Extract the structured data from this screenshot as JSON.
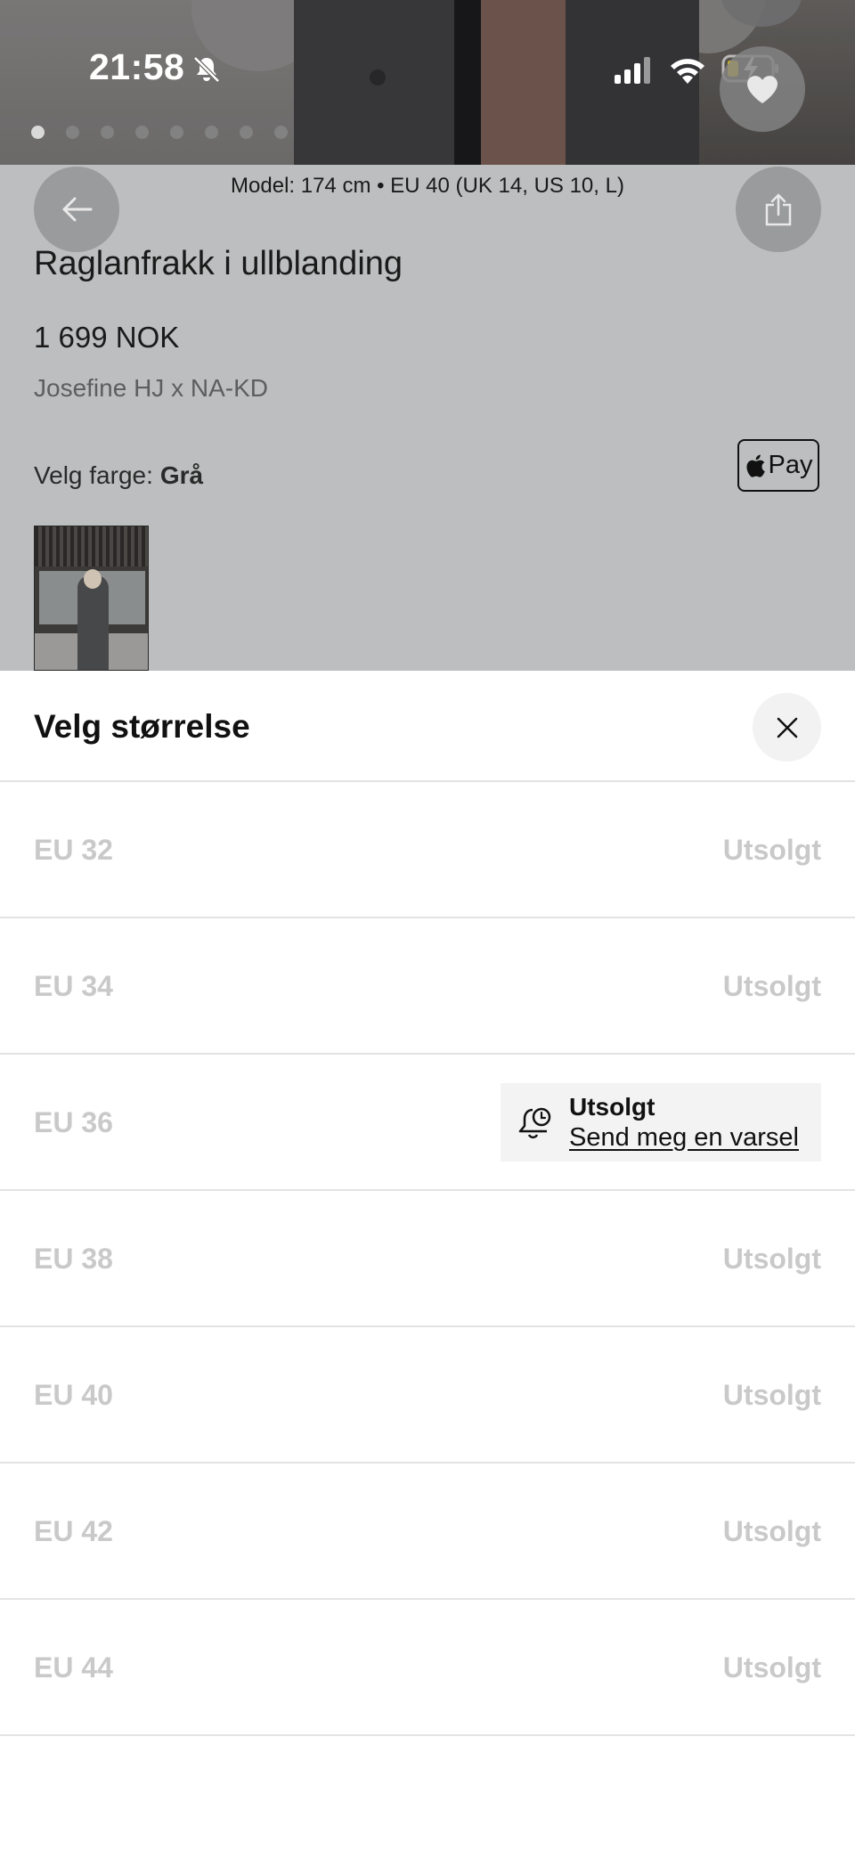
{
  "status_bar": {
    "time": "21:58"
  },
  "gallery": {
    "image_count": 8,
    "active_index": 0
  },
  "product": {
    "model_info": "Model: 174 cm • EU 40 (UK 14, US 10, L)",
    "title": "Raglanfrakk i ullblanding",
    "price": "1 699 NOK",
    "brand": "Josefine HJ x NA-KD",
    "color_label": "Velg farge:",
    "color_value": "Grå",
    "apple_pay_label": "Pay"
  },
  "size_sheet": {
    "title": "Velg størrelse",
    "sizes": [
      {
        "label": "EU 32",
        "status": "Utsolgt"
      },
      {
        "label": "EU 34",
        "status": "Utsolgt"
      },
      {
        "label": "EU 36",
        "status": "Utsolgt",
        "notify_link": "Send meg en varsel"
      },
      {
        "label": "EU 38",
        "status": "Utsolgt"
      },
      {
        "label": "EU 40",
        "status": "Utsolgt"
      },
      {
        "label": "EU 42",
        "status": "Utsolgt"
      },
      {
        "label": "EU 44",
        "status": "Utsolgt"
      }
    ]
  },
  "colors": {
    "overlay_panel": "#bdbebf",
    "disabled_text": "#c9c9c9",
    "divider": "#e3e3e3"
  },
  "icons": [
    "bell-slash-icon",
    "signal-icon",
    "wifi-icon",
    "battery-charging-icon",
    "heart-icon",
    "arrow-left-icon",
    "share-icon",
    "apple-logo-icon",
    "close-icon",
    "bell-clock-icon"
  ]
}
